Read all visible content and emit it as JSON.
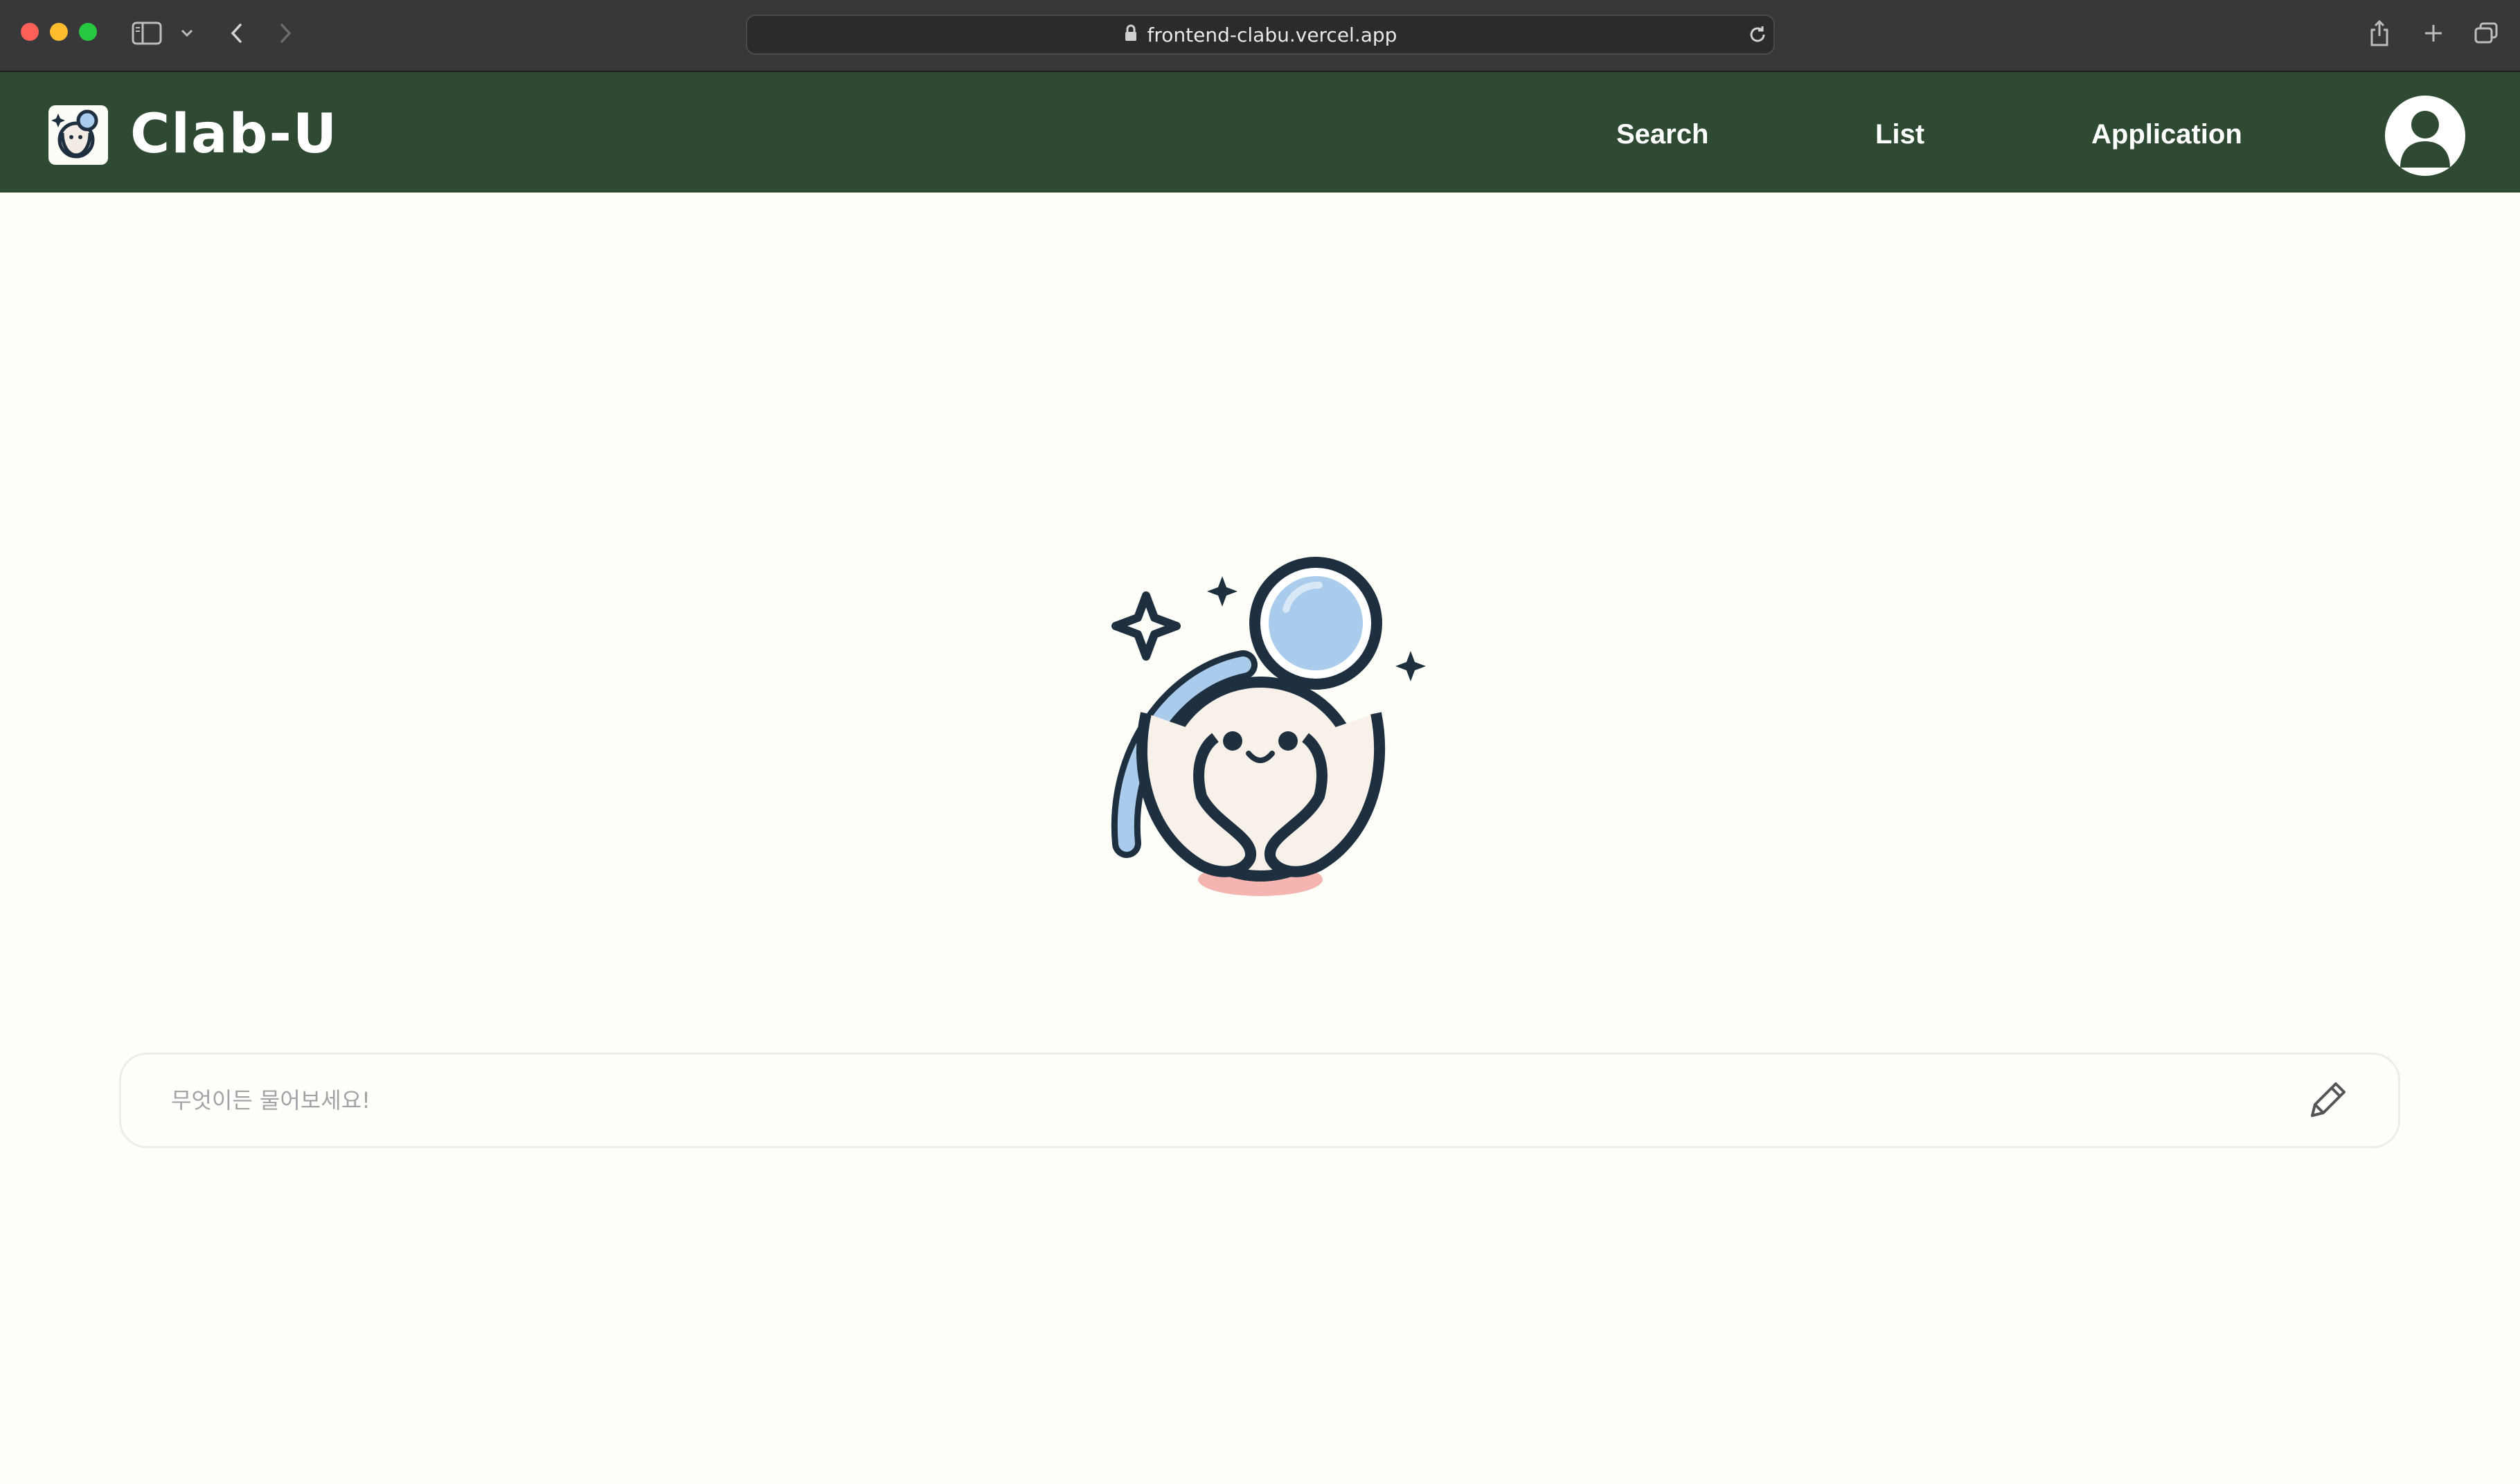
{
  "browser": {
    "url": "frontend-clabu.vercel.app"
  },
  "header": {
    "brand": "Clab-U",
    "nav": {
      "search": "Search",
      "list": "List",
      "application": "Application"
    }
  },
  "main": {
    "search": {
      "placeholder": "무엇이든 물어보세요!",
      "value": ""
    }
  },
  "colors": {
    "header_bg": "#2e4a33",
    "page_bg": "#fefef8",
    "chrome_bg": "#38383a"
  },
  "icons": {
    "lock": "lock-icon",
    "reload": "reload-icon",
    "share": "share-icon",
    "new_tab": "plus-icon",
    "tabs": "tab-overview-icon",
    "sidebar": "sidebar-icon",
    "back": "chevron-left-icon",
    "forward": "chevron-right-icon",
    "user": "user-icon",
    "edit": "pencil-icon"
  }
}
